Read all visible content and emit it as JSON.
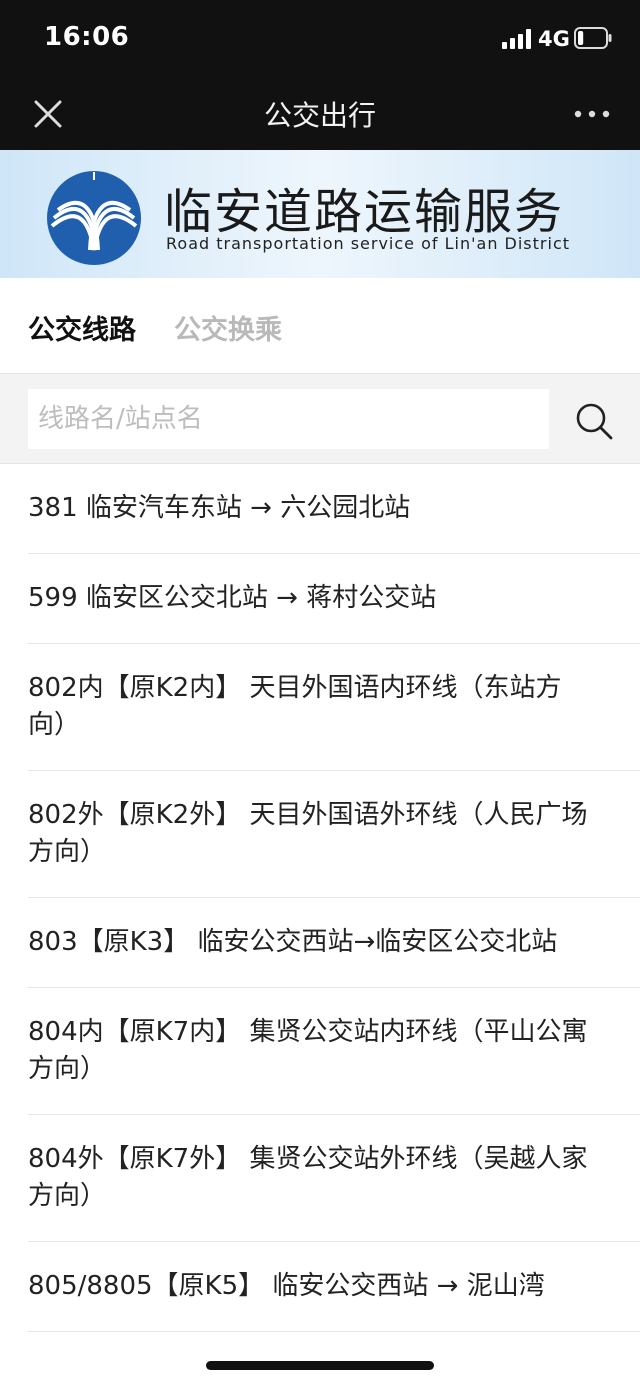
{
  "status_bar": {
    "time": "16:06",
    "network": "4G",
    "battery_level": 0.2
  },
  "nav": {
    "title": "公交出行",
    "close_icon": "close-icon",
    "more_icon": "more-dots-icon"
  },
  "banner": {
    "title": "临安道路运输服务",
    "subtitle": "Road transportation service of Lin'an District",
    "logo_colors": [
      "#1f5fae",
      "#ffffff"
    ]
  },
  "tabs": [
    {
      "label": "公交线路",
      "active": true
    },
    {
      "label": "公交换乘",
      "active": false
    }
  ],
  "search": {
    "placeholder": "线路名/站点名",
    "value": "",
    "icon": "search-icon"
  },
  "routes": [
    {
      "label": "381 临安汽车东站 → 六公园北站"
    },
    {
      "label": "599 临安区公交北站 → 蒋村公交站"
    },
    {
      "label": "802内【原K2内】 天目外国语内环线（东站方向）"
    },
    {
      "label": "802外【原K2外】 天目外国语外环线（人民广场方向）"
    },
    {
      "label": "803【原K3】 临安公交西站→临安区公交北站"
    },
    {
      "label": "804内【原K7内】 集贤公交站内环线（平山公寓方向）"
    },
    {
      "label": "804外【原K7外】 集贤公交站外环线（吴越人家方向）"
    },
    {
      "label": "805/8805【原K5】 临安公交西站 → 泥山湾"
    }
  ],
  "colors": {
    "header_bg": "#111111",
    "active_tab": "#111111",
    "inactive_tab": "#b9b9b9",
    "divider": "#e6e6e6"
  }
}
